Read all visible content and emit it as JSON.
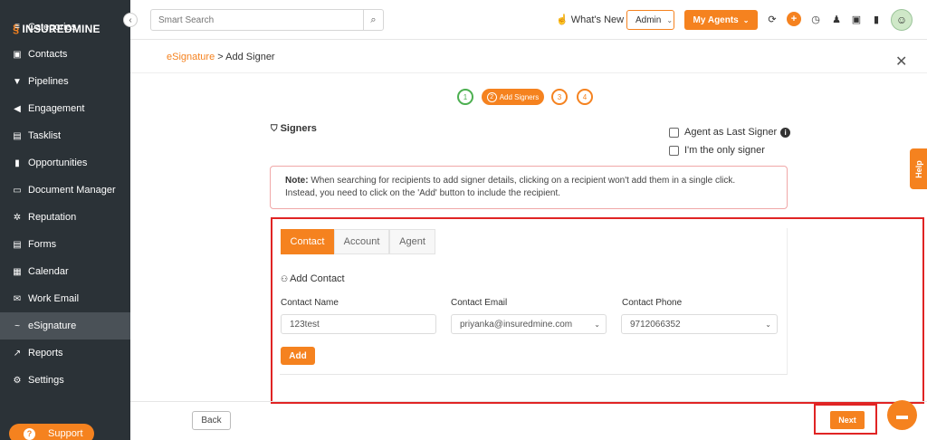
{
  "app": {
    "logo_text_bold": "INSUREDMINE",
    "accent_color": "#f5821f",
    "sidebar_color": "#2b3237"
  },
  "sidebar": {
    "items": [
      {
        "label": "Categories",
        "icon": "list-icon"
      },
      {
        "label": "Contacts",
        "icon": "contact-card-icon"
      },
      {
        "label": "Pipelines",
        "icon": "funnel-icon"
      },
      {
        "label": "Engagement",
        "icon": "megaphone-icon"
      },
      {
        "label": "Tasklist",
        "icon": "task-icon"
      },
      {
        "label": "Opportunities",
        "icon": "bar-chart-icon"
      },
      {
        "label": "Document Manager",
        "icon": "folder-icon"
      },
      {
        "label": "Reputation",
        "icon": "reputation-icon"
      },
      {
        "label": "Forms",
        "icon": "form-icon"
      },
      {
        "label": "Calendar",
        "icon": "calendar-icon"
      },
      {
        "label": "Work Email",
        "icon": "mail-icon"
      },
      {
        "label": "eSignature",
        "icon": "signature-icon",
        "active": true
      },
      {
        "label": "Reports",
        "icon": "line-chart-icon"
      },
      {
        "label": "Settings",
        "icon": "gear-icon"
      }
    ],
    "support_label": "Support"
  },
  "topbar": {
    "search_placeholder": "Smart Search",
    "whats_new": "What's New",
    "admin_label": "Admin",
    "my_agents_label": "My Agents"
  },
  "page": {
    "breadcrumb_link": "eSignature",
    "breadcrumb_sep": ">",
    "breadcrumb_current": "Add Signer"
  },
  "stepper": {
    "step1": "1",
    "step2_num": "2",
    "step2_label": "Add Signers",
    "step3": "3",
    "step4": "4"
  },
  "signers": {
    "title": "Signers",
    "agent_last_label": "Agent as Last Signer",
    "only_signer_label": "I'm the only signer",
    "note_bold": "Note:",
    "note_line1": "When searching for recipients to add signer details, clicking on a recipient won't add them in a single click.",
    "note_line2": "Instead, you need to click on the 'Add' button to include the recipient."
  },
  "form": {
    "tabs": [
      "Contact",
      "Account",
      "Agent"
    ],
    "active_tab": "Contact",
    "add_contact_label": "Add Contact",
    "name_label": "Contact Name",
    "name_value": "123test",
    "email_label": "Contact Email",
    "email_value": "priyanka@insuredmine.com",
    "phone_label": "Contact Phone",
    "phone_value": "9712066352",
    "add_button": "Add"
  },
  "footer": {
    "back_label": "Back",
    "next_label": "Next",
    "help_label": "Help"
  }
}
